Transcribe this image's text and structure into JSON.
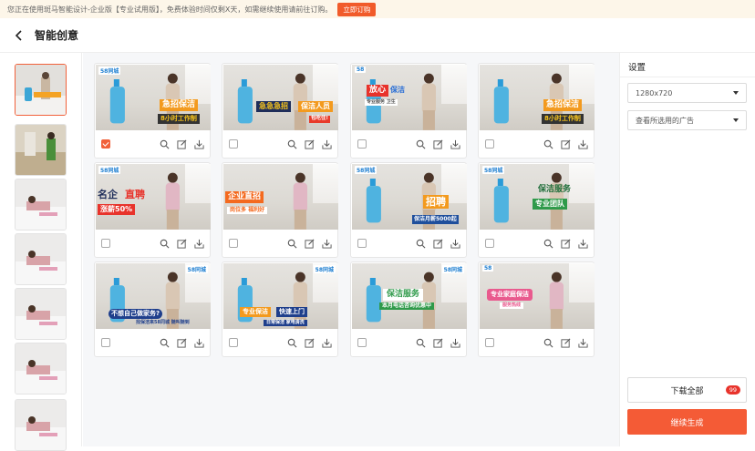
{
  "banner": {
    "notice": "您正在使用斑马智能设计-企业版【专业试用版】，免费体验时间仅剩X天，如需继续使用请前往订购。",
    "buy_label": "立即订购"
  },
  "header": {
    "title": "智能创意",
    "back_icon": "chevron-left-icon"
  },
  "thumbnails": [
    {
      "selected": true
    },
    {
      "selected": false
    },
    {
      "selected": false
    },
    {
      "selected": false
    },
    {
      "selected": false
    },
    {
      "selected": false
    },
    {
      "selected": false
    }
  ],
  "cards": [
    {
      "logo": "58同城",
      "texts": [
        "急招保洁",
        "8小时工作制"
      ],
      "checked": true
    },
    {
      "logo": "",
      "texts": [
        "急急急招",
        "保洁人员",
        "包吃住!"
      ],
      "checked": false
    },
    {
      "logo": "58",
      "texts": [
        "放心",
        "保洁",
        "专业服务 卫生"
      ],
      "checked": false
    },
    {
      "logo": "",
      "texts": [
        "急招保洁",
        "8小时工作制"
      ],
      "checked": false
    },
    {
      "logo": "58同城",
      "texts": [
        "名企",
        "直聘",
        "涨薪50%"
      ],
      "checked": false
    },
    {
      "logo": "",
      "texts": [
        "企业直招",
        "岗位多 福利好"
      ],
      "checked": false
    },
    {
      "logo": "58同城",
      "texts": [
        "招聘",
        "保洁月薪5000起"
      ],
      "checked": false
    },
    {
      "logo": "58同城",
      "texts": [
        "保洁服务",
        "专业团队"
      ],
      "checked": false
    },
    {
      "logo": "58同城",
      "texts": [
        "不想自己做家务?",
        "找保洁来58同城 随叫随到"
      ],
      "checked": false
    },
    {
      "logo": "58同城",
      "texts": [
        "专业保洁",
        "快速上门",
        "日常保洁 家电清洗"
      ],
      "checked": false
    },
    {
      "logo": "58同城",
      "texts": [
        "保洁服务",
        "本月电话咨询优惠中"
      ],
      "checked": false
    },
    {
      "logo": "58",
      "texts": [
        "专业家庭保洁",
        "服务热线"
      ],
      "checked": false
    }
  ],
  "settings": {
    "title": "设置",
    "size_value": "1280x720",
    "ads_value": "查看所选用的广告",
    "download_label": "下载全部",
    "download_count": "99",
    "generate_label": "继续生成"
  },
  "colors": {
    "accent": "#f45b36",
    "checked": "#f1613a",
    "badge": "#e8332b"
  }
}
